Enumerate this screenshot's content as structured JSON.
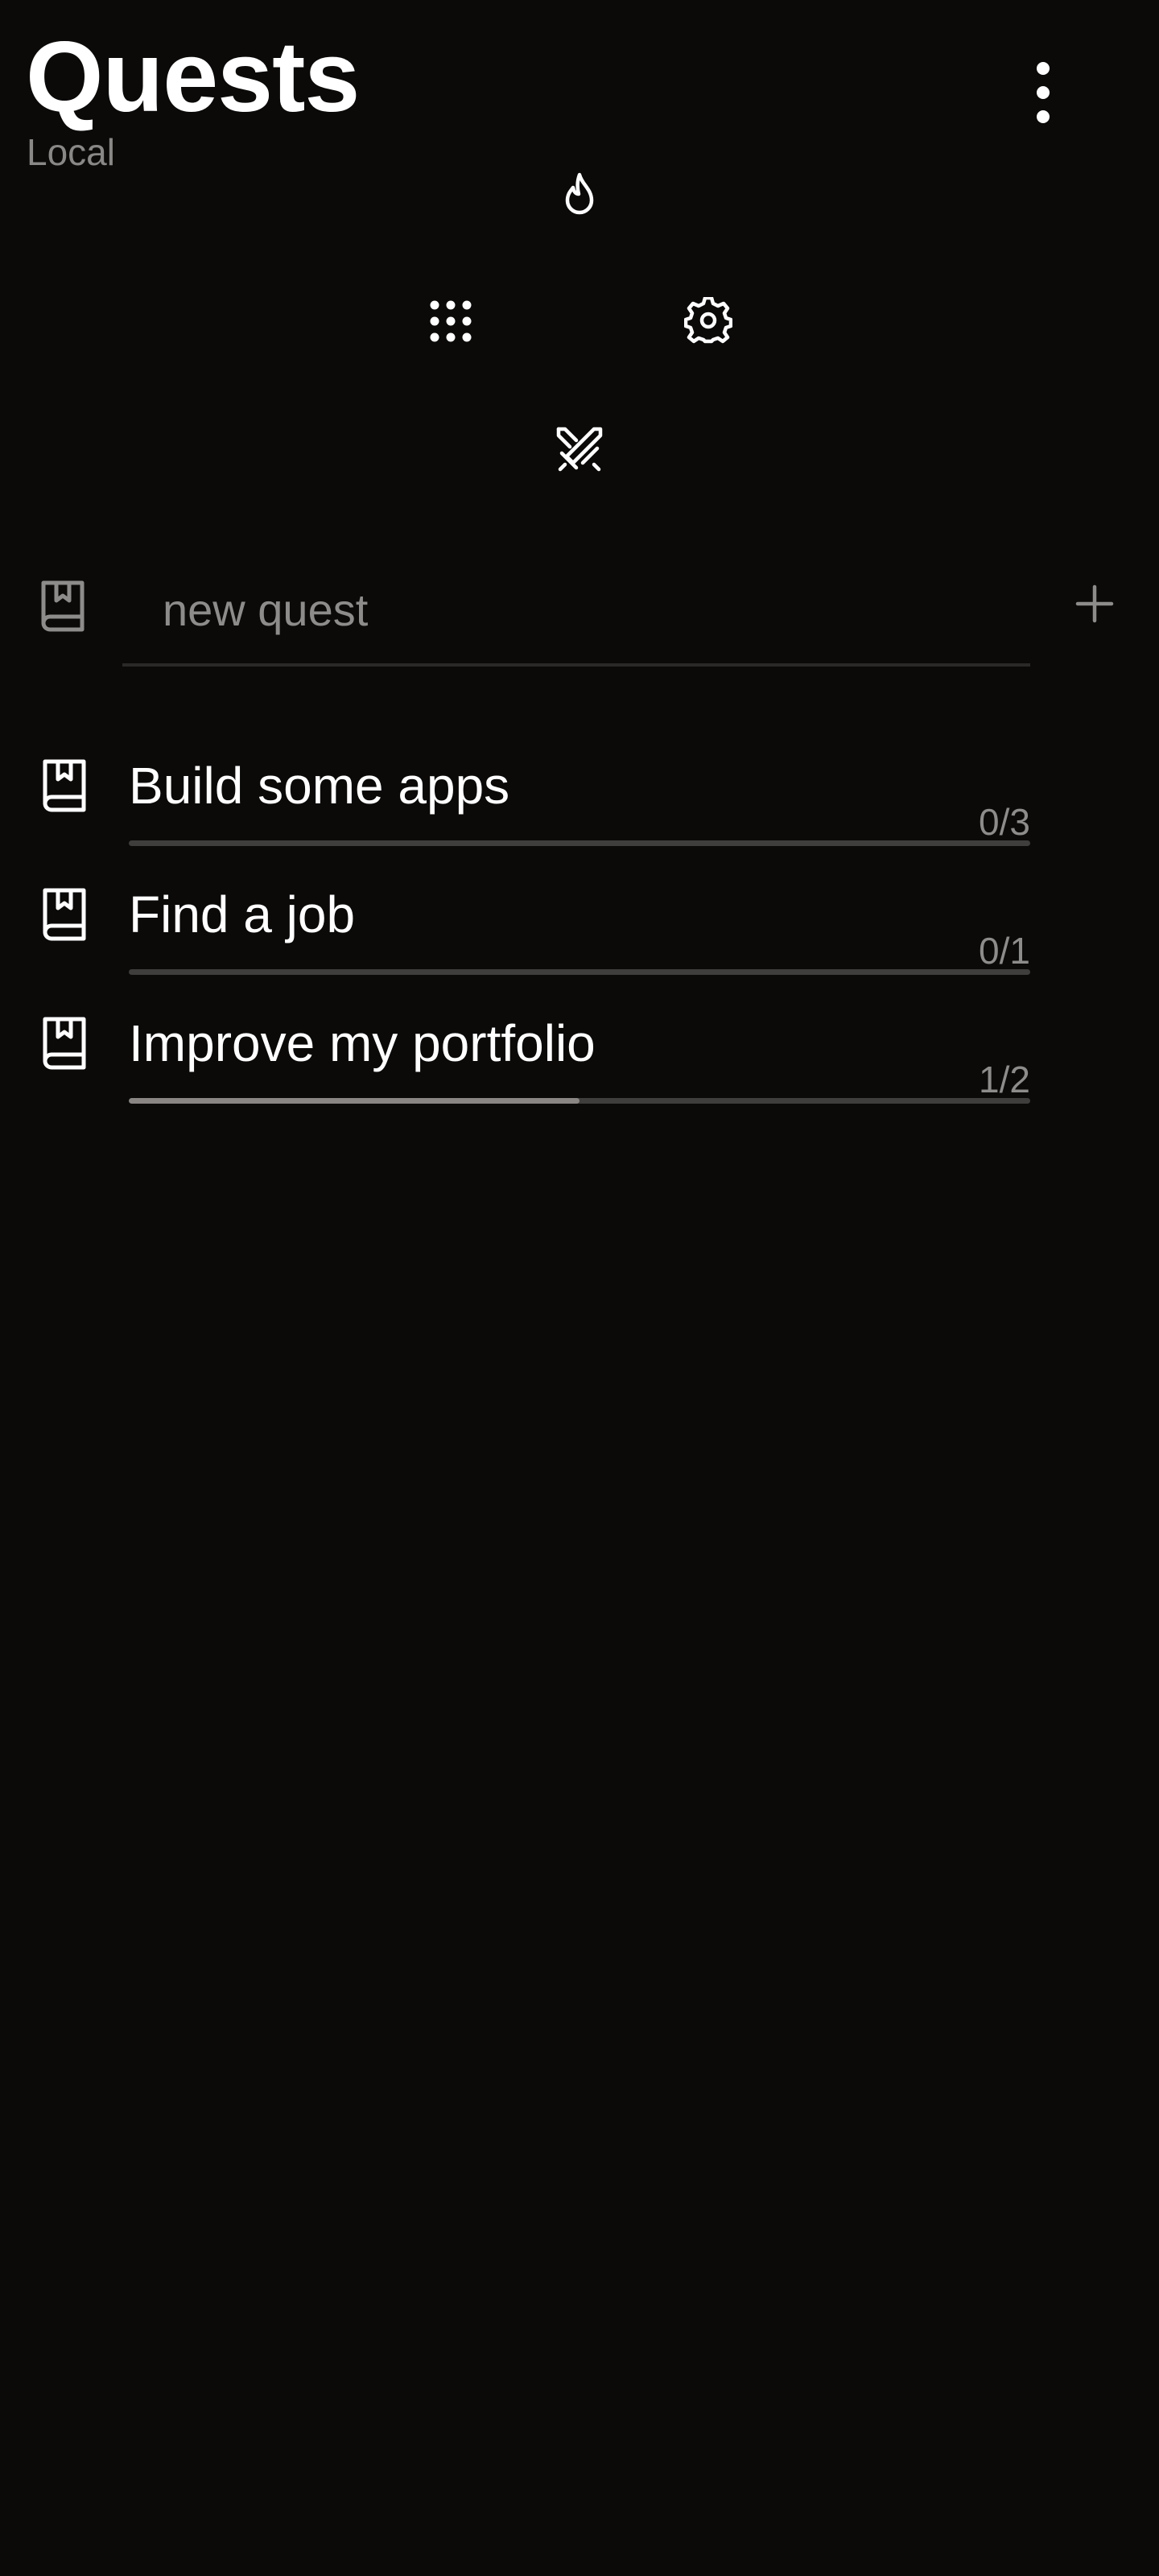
{
  "header": {
    "title": "Quests",
    "subtitle": "Local",
    "menu_icon": "more-vertical-icon"
  },
  "radial_menu": [
    {
      "name": "flame-icon"
    },
    {
      "name": "grid-dots-icon"
    },
    {
      "name": "gear-icon"
    },
    {
      "name": "crossed-swords-icon"
    }
  ],
  "new_quest": {
    "placeholder": "new quest",
    "value": "",
    "icon": "bookmark-book-icon",
    "add_icon": "plus-icon"
  },
  "quests": [
    {
      "name": "Build some apps",
      "count": "0/3",
      "progress": 0.0,
      "icon": "bookmark-book-icon"
    },
    {
      "name": "Find a job",
      "count": "0/1",
      "progress": 0.0,
      "icon": "bookmark-book-icon"
    },
    {
      "name": "Improve my portfolio",
      "count": "1/2",
      "progress": 0.5,
      "icon": "bookmark-book-icon"
    }
  ],
  "colors": {
    "background": "#0b0a09",
    "text": "#ffffff",
    "muted": "#8e8c8a",
    "track": "#403e3c",
    "fill": "#8a8684"
  }
}
